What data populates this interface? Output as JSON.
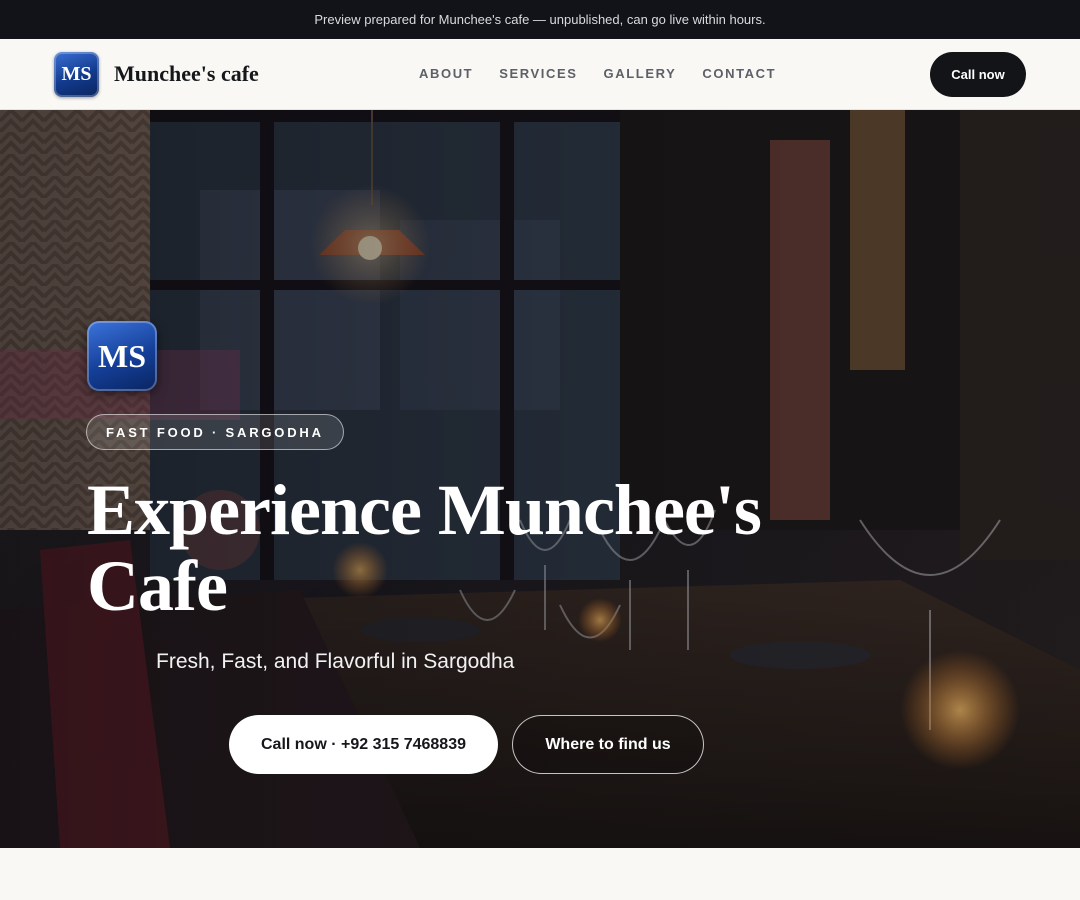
{
  "announcement": "Preview prepared for Munchee's cafe — unpublished, can go live within hours.",
  "nav": {
    "logo_text": "MS",
    "brand": "Munchee's cafe",
    "links": [
      "ABOUT",
      "SERVICES",
      "GALLERY",
      "CONTACT"
    ],
    "cta": "Call now"
  },
  "hero": {
    "logo_text": "MS",
    "tag": "FAST FOOD · SARGODHA",
    "title": "Experience Munchee's Cafe",
    "subtitle": "Fresh, Fast, and Flavorful in Sargodha",
    "primary_button": "Call now · +92 315 7468839",
    "secondary_button": "Where to find us"
  },
  "colors": {
    "topbar_bg": "#111318",
    "nav_bg": "#f9f8f5",
    "logo_blue": "#143f98",
    "cta_dark": "#121418"
  }
}
